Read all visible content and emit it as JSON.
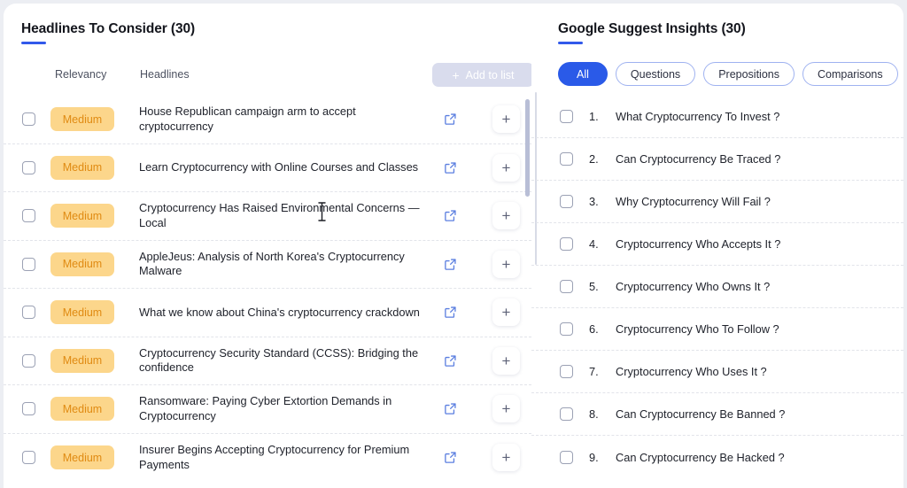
{
  "left_panel": {
    "title": "Headlines To Consider (30)",
    "columns": {
      "relevancy": "Relevancy",
      "headlines": "Headlines"
    },
    "add_to_list": {
      "label": "Add to list",
      "plus": "+",
      "disabled": true
    },
    "rows": [
      {
        "relevancy": "Medium",
        "headline": "House Republican campaign arm to accept cryptocurrency",
        "add": "+"
      },
      {
        "relevancy": "Medium",
        "headline": "Learn Cryptocurrency with Online Courses and Classes",
        "add": "+"
      },
      {
        "relevancy": "Medium",
        "headline": "Cryptocurrency Has Raised Environmental Concerns — Local",
        "add": "+"
      },
      {
        "relevancy": "Medium",
        "headline": "AppleJeus: Analysis of North Korea's Cryptocurrency Malware",
        "add": "+"
      },
      {
        "relevancy": "Medium",
        "headline": "What we know about China's cryptocurrency crackdown",
        "add": "+"
      },
      {
        "relevancy": "Medium",
        "headline": "Cryptocurrency Security Standard (CCSS): Bridging the confidence",
        "add": "+"
      },
      {
        "relevancy": "Medium",
        "headline": "Ransomware: Paying Cyber Extortion Demands in Cryptocurrency",
        "add": "+"
      },
      {
        "relevancy": "Medium",
        "headline": "Insurer Begins Accepting Cryptocurrency for Premium Payments",
        "add": "+"
      }
    ]
  },
  "right_panel": {
    "title": "Google Suggest Insights (30)",
    "filters": [
      {
        "label": "All",
        "active": true
      },
      {
        "label": "Questions",
        "active": false
      },
      {
        "label": "Prepositions",
        "active": false
      },
      {
        "label": "Comparisons",
        "active": false
      }
    ],
    "items": [
      {
        "number": "1.",
        "text": "What Cryptocurrency To Invest ?"
      },
      {
        "number": "2.",
        "text": "Can Cryptocurrency Be Traced ?"
      },
      {
        "number": "3.",
        "text": "Why Cryptocurrency Will Fail ?"
      },
      {
        "number": "4.",
        "text": "Cryptocurrency Who Accepts It ?"
      },
      {
        "number": "5.",
        "text": "Cryptocurrency Who Owns It ?"
      },
      {
        "number": "6.",
        "text": "Cryptocurrency Who To Follow ?"
      },
      {
        "number": "7.",
        "text": "Cryptocurrency Who Uses It ?"
      },
      {
        "number": "8.",
        "text": "Can Cryptocurrency Be Banned ?"
      },
      {
        "number": "9.",
        "text": "Can Cryptocurrency Be Hacked ?"
      }
    ]
  },
  "colors": {
    "accent_blue": "#3159ea",
    "pill_active_bg": "#2a5ae8",
    "badge_bg": "#fcd68b",
    "badge_text": "#e08b13",
    "page_bg": "#eceef3",
    "disabled_button_bg": "#d9dced",
    "scrollbar_thumb": "#b8bed6"
  },
  "icons": {
    "external_link": "external-link-icon",
    "plus": "plus-icon",
    "checkbox": "checkbox-icon",
    "text_cursor": "text-cursor-icon"
  }
}
